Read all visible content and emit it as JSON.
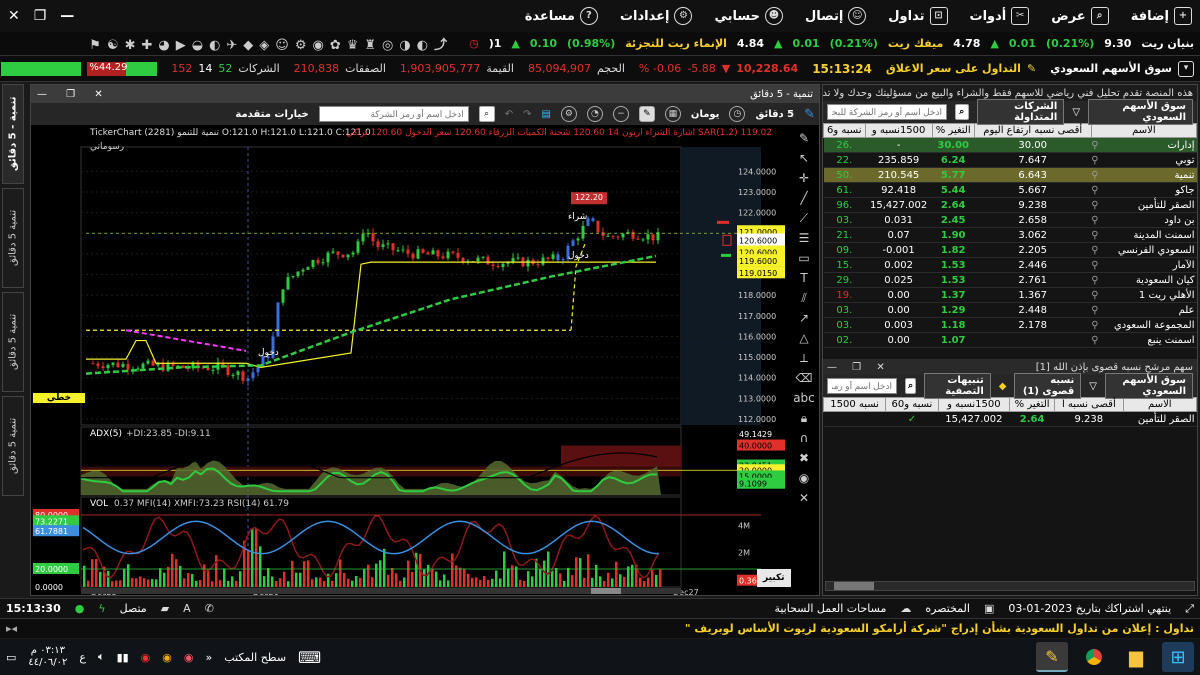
{
  "menu": [
    {
      "label": "إضافة",
      "icon": "plus-square-icon"
    },
    {
      "label": "عرض",
      "icon": "view-search-icon"
    },
    {
      "label": "أدوات",
      "icon": "tools-icon"
    },
    {
      "label": "تداول",
      "icon": "cart-icon"
    },
    {
      "label": "إتصال",
      "icon": "user-circle-icon"
    },
    {
      "label": "حسابي",
      "icon": "account-icon"
    },
    {
      "label": "إعدادات",
      "icon": "gear-icon"
    },
    {
      "label": "مساعدة",
      "icon": "help-icon"
    }
  ],
  "window_controls": {
    "minimize": "—",
    "restore": "❐",
    "close": "✕"
  },
  "ticker": [
    {
      "name": "بنيان ريت",
      "price": "9.30",
      "cls": "wh"
    },
    {
      "pct": "(0.21%)",
      "chg": "0.01",
      "price": "4.78",
      "name": "ميفك ريت"
    },
    {
      "pct": "(0.21%)",
      "chg": "0.01",
      "price": "4.84",
      "name": "الإنماء ريت للتجزئة"
    },
    {
      "pct": "(0.98%)",
      "chg": "0.10",
      "price": "1("
    }
  ],
  "stats": {
    "market_label": "سوق الأسهم السعودي",
    "trading_label": "التداول على سعر الاغلاق",
    "time": "15:13:24",
    "index_value": "10,228.64",
    "index_change": "5.88-",
    "index_pct": "0.06- %",
    "volume_label": "الحجم",
    "volume": "85,094,907",
    "value_label": "القيمة",
    "value": "1,903,905,777",
    "deals_label": "الصفقات",
    "deals": "210,838",
    "companies_label": "الشركات",
    "comp_up": "52",
    "comp_flat": "14",
    "comp_down": "152",
    "breadth": "%44.29"
  },
  "vtabs": [
    "تنمية - 5 دقائق",
    "تنمية 5 دقائق",
    "تنمية 5 دقائق",
    "تنمية 5 دقائق",
    "تنمية"
  ],
  "chart": {
    "window_title": "تنمية - 5 دقائق",
    "interval": "5 دقائق",
    "range": "يومان",
    "search_placeholder": "ادخل اسم أو رمز الشركة",
    "advanced": "خيارات متقدمة",
    "header_left": "TickerChart  تنمية للتنمو (2281) O:121.0  H:121.0  L:121.0  C:121.0",
    "header_right": "SAR(1.2) 119.02  اشارة الشراء اربون 14  120.60  شحنة الكميات الزرقاء  120.60  سعر الدخول  120.60  تراكي",
    "draw_label": "رسوماتي",
    "ann_buy": "شراء",
    "ann_entry1": "دخول",
    "ann_entry2": "دخول",
    "hline_label": "خطي",
    "adx_label": "ADX(5)",
    "adx_di": "+DI:23.85  -DI:9.11",
    "vol_label": "VOL",
    "vol_vals": "0.37  MFI(14)  XMFI:73.23  RSI(14)  61.79",
    "zoom_label": "تكبير",
    "x_labels": [
      "Dec25",
      "Dec26",
      "Dec27"
    ],
    "price_axis": [
      "124.0000",
      "123.0000",
      "122.0000",
      "121.0000",
      "120.0000",
      "119.0000",
      "118.0000",
      "117.0000",
      "116.0000",
      "115.0000",
      "114.0000",
      "113.0000",
      "112.0000"
    ],
    "price_badges": [
      {
        "v": "121.0000",
        "c": "#f5f12a"
      },
      {
        "v": "120.6000",
        "c": "#ffffff"
      },
      {
        "v": "120.6000",
        "c": "#f5f12a"
      },
      {
        "v": "119.6000",
        "c": "#f5f12a"
      },
      {
        "v": "119.6000",
        "c": "#f5f12a"
      },
      {
        "v": "119.0150",
        "c": "#f5f12a"
      }
    ],
    "peak_badge": "122.20",
    "adx_axis": [
      "49.1429",
      "40.0000",
      "23.8451",
      "20.0000",
      "15.0000",
      "9.1099"
    ],
    "adx_badge_colors": [
      "#000",
      "#e0302a",
      "#2ecc40",
      "#f5f12a",
      "#2ecc40",
      "#2ecc40"
    ],
    "left_badges": [
      {
        "v": "80.0000",
        "c": "#e0302a"
      },
      {
        "v": "73.2271",
        "c": "#2ecc40"
      },
      {
        "v": "61.7881",
        "c": "#3a8fe0"
      },
      {
        "v": "20.0000",
        "c": "#2ecc40"
      },
      {
        "v": "0.0000",
        "c": "#000"
      }
    ],
    "vol_axis": [
      "4M",
      "2M"
    ],
    "vol_badge": "0.36"
  },
  "right": {
    "news": "هذه المنصة تقدم تحليل فني رياضي للاسهم  فقط والشراء والبيع من مسؤليتك وحدك ولا تد",
    "market_btn": "سوق الأسهم السعودي",
    "filter_btn": "الشركات المتداولة",
    "search_placeholder": "ادخل اسم أو رمز الشركة للبحث",
    "headers": [
      "الاسم",
      "أقصى نسبه ارتفاع اليوم",
      "التغير %",
      "1500نسبه و",
      "نسبه و6"
    ],
    "rows": [
      [
        "إدارات",
        "30.00",
        "30.00",
        "-",
        ".26"
      ],
      [
        "توبي",
        "7.647",
        "6.24",
        "235.859",
        ".22"
      ],
      [
        "تنمية",
        "6.643",
        "5.77",
        "210.545",
        ".50"
      ],
      [
        "جاكو",
        "5.667",
        "5.44",
        "92.418",
        ".61"
      ],
      [
        "الصقر للتأمين",
        "9.238",
        "2.64",
        "15,427.002",
        ".96"
      ],
      [
        "بن داود",
        "2.658",
        "2.45",
        "0.031",
        ".03"
      ],
      [
        "اسمنت المدينة",
        "3.062",
        "1.90",
        "0.07",
        ".21"
      ],
      [
        "السعودي الفرنسي",
        "2.205",
        "1.82",
        "0.001-",
        ".09"
      ],
      [
        "الآمار",
        "2.446",
        "1.53",
        "0.002",
        ".15"
      ],
      [
        "كيان السعودية",
        "2.761",
        "1.53",
        "0.025",
        ".29"
      ],
      [
        "الأهلي ريت 1",
        "1.367",
        "1.37",
        "0.00",
        ".19"
      ],
      [
        "علم",
        "2.448",
        "1.29",
        "0.00",
        ".03"
      ],
      [
        "المجموعة السعودي",
        "2.178",
        "1.18",
        "0.003",
        ".03"
      ],
      [
        "اسمنت ينبع",
        "",
        "1.07",
        "0.00",
        ".02"
      ]
    ],
    "alert_title": "سهم مرشح نسبه قصوى بإذن الله [1]",
    "alert_market": "سوق الأسهم السعودي",
    "alert_filter": "نسبه قصوى (1)",
    "alert_btn": "تنبيهات التصفية",
    "alert_search": "ادخل اسم أو رمز الشركة",
    "alert_headers": [
      "الاسم",
      "أقصى نسبه ا",
      "التغير %",
      "1500نسبه و",
      "نسبه و60",
      "نسبه 1500"
    ],
    "alert_row": [
      "الصقر للتأمين",
      "9.238",
      "2.64",
      "15,427.002",
      "✓",
      ""
    ]
  },
  "status": {
    "time": "15:13:30",
    "connected": "متصل",
    "subscription": "ينتهي اشتراكك بتاريخ 2023-01-03",
    "shortcut": "المختصره",
    "cloud": "مساحات العمل السحابية"
  },
  "news_ticker": "تداول : إعلان من تداول السعودية بشأن إدراج \"شركة أرامكو السعودية لزيوت الأساس لوبريف \"",
  "taskbar": {
    "desktop": "سطح المكتب",
    "time": "٠٣:١٣ م",
    "date": "٤٤/٠٦/٠٢",
    "lang": "ع"
  }
}
